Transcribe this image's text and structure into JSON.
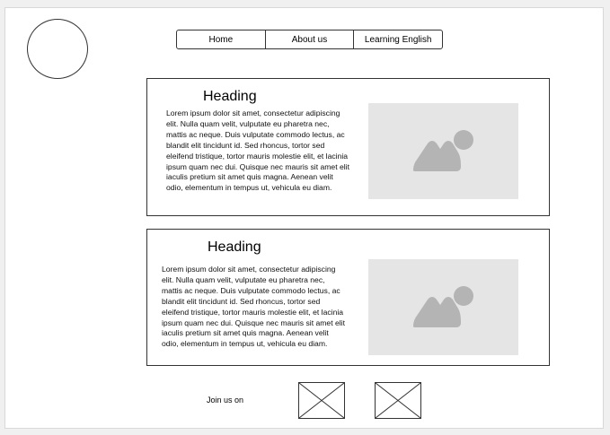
{
  "nav": {
    "items": [
      {
        "label": "Home"
      },
      {
        "label": "About us"
      },
      {
        "label": "Learning English"
      }
    ]
  },
  "cards": [
    {
      "heading": "Heading",
      "body": "Lorem ipsum dolor sit amet, consectetur adipiscing elit. Nulla quam velit, vulputate eu pharetra nec, mattis ac neque. Duis vulputate commodo lectus, ac blandit elit tincidunt id. Sed rhoncus, tortor sed eleifend tristique, tortor mauris molestie elit, et lacinia ipsum quam nec dui. Quisque nec mauris sit amet elit iaculis pretium sit amet quis magna. Aenean velit odio, elementum in tempus ut, vehicula eu diam."
    },
    {
      "heading": "Heading",
      "body": "Lorem ipsum dolor sit amet, consectetur adipiscing elit. Nulla quam velit, vulputate eu pharetra nec, mattis ac neque. Duis vulputate commodo lectus, ac blandit elit tincidunt id. Sed rhoncus, tortor sed eleifend tristique, tortor mauris molestie elit, et lacinia ipsum quam nec dui. Quisque nec mauris sit amet elit iaculis pretium sit amet quis magna. Aenean velit odio, elementum in tempus ut, vehicula eu diam."
    }
  ],
  "footer": {
    "join_label": "Join us on"
  },
  "icons": {
    "logo": "circle-logo-placeholder",
    "image": "image-placeholder-icon",
    "social": "x-box-placeholder-icon"
  },
  "colors": {
    "border": "#333333",
    "placeholder_bg": "#e5e5e5",
    "placeholder_icon": "#b4b4b4",
    "page_bg": "#ffffff",
    "canvas_bg": "#f0f0f0"
  }
}
